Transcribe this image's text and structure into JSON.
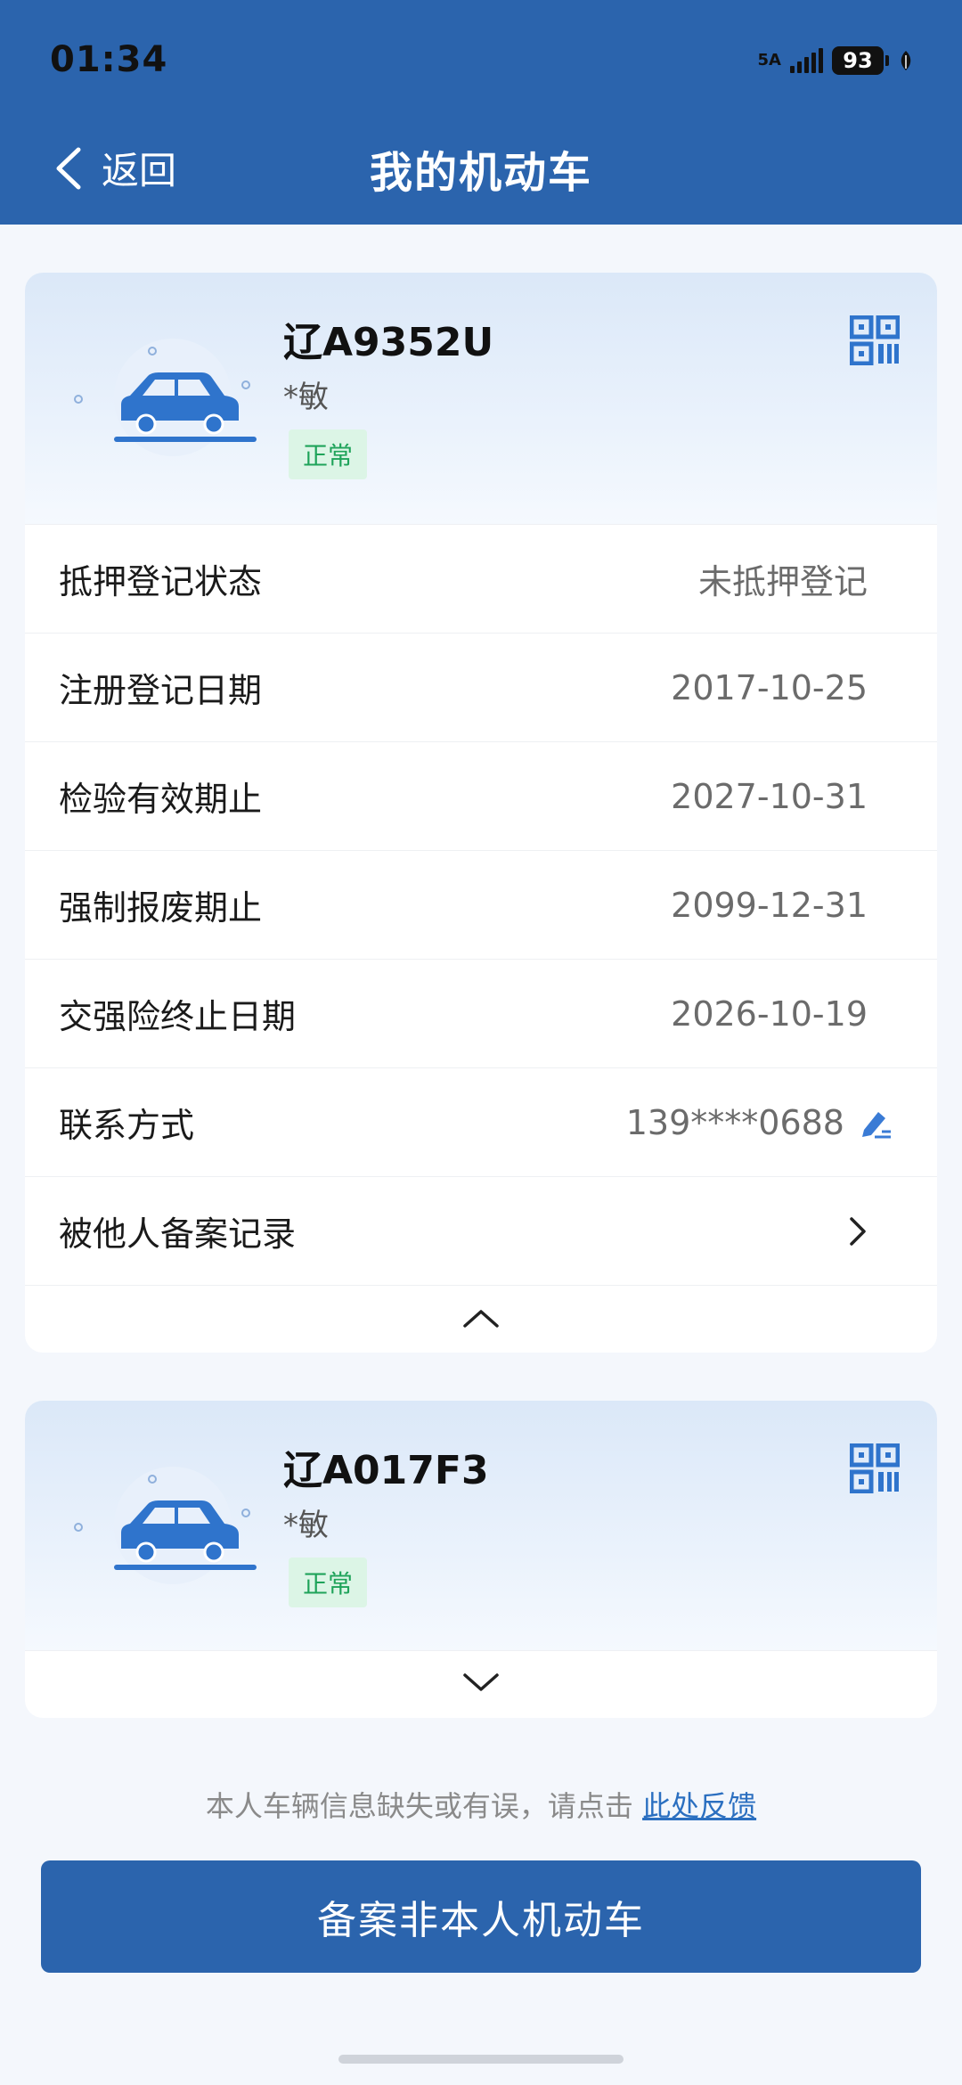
{
  "status_bar": {
    "time": "01:34",
    "network": "5A",
    "battery": "93"
  },
  "header": {
    "back_label": "返回",
    "title": "我的机动车"
  },
  "vehicles": [
    {
      "plate": "辽A9352U",
      "owner": "*敏",
      "status": "正常",
      "expanded": true,
      "details": [
        {
          "label": "抵押登记状态",
          "value": "未抵押登记"
        },
        {
          "label": "注册登记日期",
          "value": "2017-10-25"
        },
        {
          "label": "检验有效期止",
          "value": "2027-10-31"
        },
        {
          "label": "强制报废期止",
          "value": "2099-12-31"
        },
        {
          "label": "交强险终止日期",
          "value": "2026-10-19"
        },
        {
          "label": "联系方式",
          "value": "139****0688"
        },
        {
          "label": "被他人备案记录",
          "value": ""
        }
      ]
    },
    {
      "plate": "辽A017F3",
      "owner": "*敏",
      "status": "正常",
      "expanded": false
    }
  ],
  "footer": {
    "feedback_text": "本人车辆信息缺失或有误，请点击",
    "feedback_link": "此处反馈",
    "button_label": "备案非本人机动车"
  },
  "colors": {
    "primary": "#2b64ad",
    "status_green": "#1fa35a",
    "link": "#2b6fc0"
  },
  "icons": [
    "back-arrow-icon",
    "qr-code-icon",
    "car-icon",
    "edit-icon",
    "chevron-right-icon",
    "chevron-up-icon",
    "chevron-down-icon"
  ]
}
